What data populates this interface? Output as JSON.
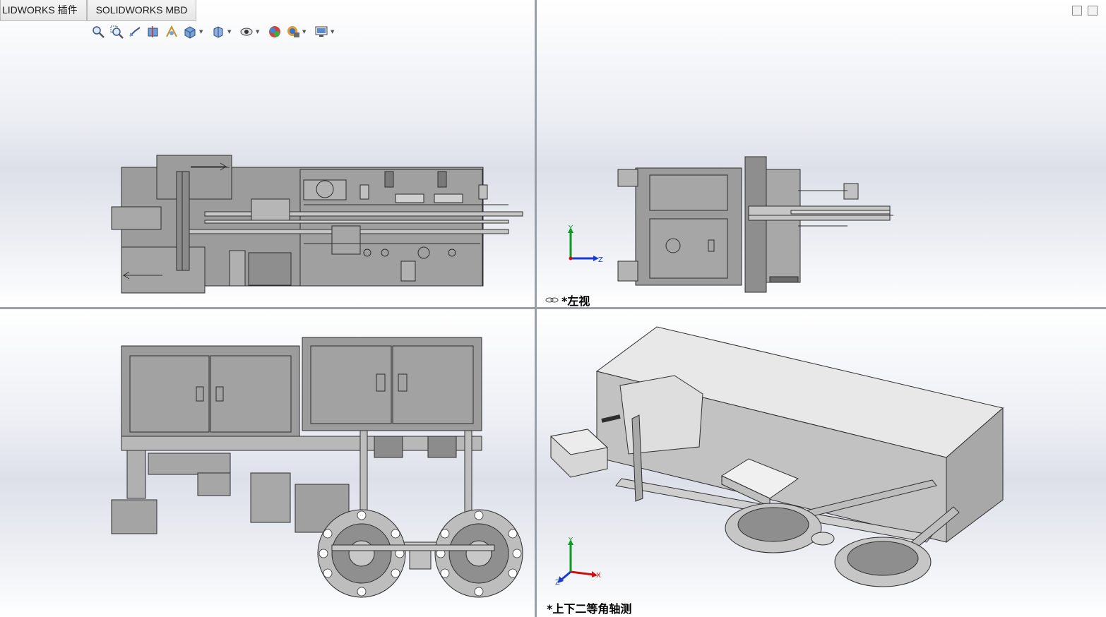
{
  "tabs": [
    {
      "label": "LIDWORKS 插件"
    },
    {
      "label": "SOLIDWORKS MBD"
    }
  ],
  "toolbar": {
    "icons": [
      "zoom-to-fit-icon",
      "zoom-area-icon",
      "previous-view-icon",
      "section-view-icon",
      "dynamic-annotation-icon",
      "view-orientation-icon",
      "display-style-icon",
      "hide-show-items-icon",
      "edit-appearance-icon",
      "apply-scene-icon",
      "view-settings-icon"
    ]
  },
  "viewports": {
    "top_left": {
      "name": "front-view",
      "label": ""
    },
    "top_right": {
      "name": "left-view",
      "label": "*左视"
    },
    "bottom_left": {
      "name": "top-view",
      "label": ""
    },
    "bottom_right": {
      "name": "isometric-view",
      "label": "*上下二等角轴测"
    }
  },
  "triads": {
    "left_view": {
      "y": "Y",
      "z": "Z"
    },
    "iso_view": {
      "y": "Y",
      "x": "X",
      "z": "Z"
    }
  },
  "colors": {
    "part_fill": "#9c9c9c",
    "part_line": "#2e2e2e",
    "axis_x": "#d01010",
    "axis_y": "#0c9a20",
    "axis_z": "#1a3ad6"
  }
}
